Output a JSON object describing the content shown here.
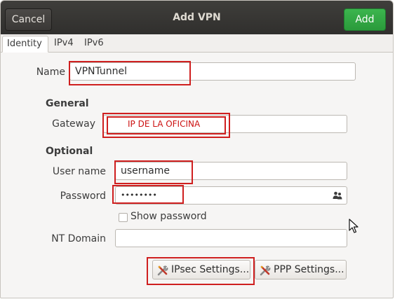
{
  "window": {
    "title": "Add VPN",
    "cancel_label": "Cancel",
    "add_label": "Add"
  },
  "tabs": [
    {
      "label": "Identity",
      "active": true
    },
    {
      "label": "IPv4",
      "active": false
    },
    {
      "label": "IPv6",
      "active": false
    }
  ],
  "identity": {
    "name_label": "Name",
    "name_value": "VPNTunnel",
    "general_heading": "General",
    "gateway_label": "Gateway",
    "gateway_value": "IP DE LA OFICINA",
    "optional_heading": "Optional",
    "username_label": "User name",
    "username_value": "username",
    "password_label": "Password",
    "password_value": "••••••••",
    "show_password_label": "Show password",
    "show_password_checked": false,
    "nt_domain_label": "NT Domain",
    "nt_domain_value": "",
    "ipsec_settings_label": "IPsec Settings...",
    "ppp_settings_label": "PPP Settings..."
  },
  "colors": {
    "headerbar": "#353432",
    "add_button": "#33a845",
    "annotation_red": "#cf1f1f",
    "gateway_text": "#cc1010"
  }
}
